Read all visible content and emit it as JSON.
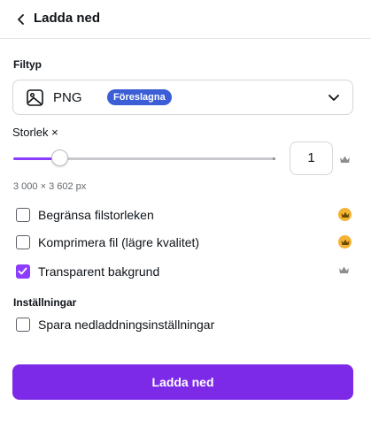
{
  "header": {
    "title": "Ladda ned"
  },
  "filetype": {
    "label": "Filtyp",
    "value": "PNG",
    "badge": "Föreslagna"
  },
  "size": {
    "label": "Storlek ×",
    "slider_value": 1,
    "slider_min": 0.125,
    "slider_max": 5,
    "input_value": "1",
    "dimensions": "3 000 × 3 602 px"
  },
  "options": [
    {
      "label": "Begränsa filstorleken",
      "checked": false,
      "crown": "gold-crown-icon"
    },
    {
      "label": "Komprimera fil (lägre kvalitet)",
      "checked": false,
      "crown": "gold-crown-icon"
    },
    {
      "label": "Transparent bakgrund",
      "checked": true,
      "crown": "crown-icon"
    }
  ],
  "settings": {
    "label": "Inställningar",
    "save_option": {
      "label": "Spara nedladdningsinställningar",
      "checked": false
    }
  },
  "download_button": {
    "label": "Ladda ned"
  },
  "colors": {
    "accent": "#7d2ae8",
    "slider": "#8b3dff",
    "badge": "#3b5dd6",
    "premium": "#f5b334"
  }
}
